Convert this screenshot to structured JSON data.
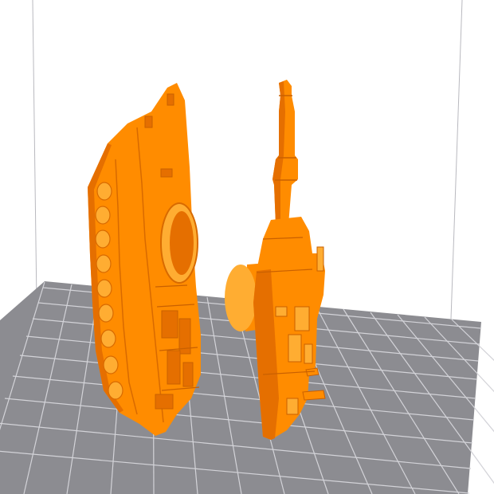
{
  "viewport": {
    "background_color": "#ffffff",
    "build_plate_color": "#8c8c91",
    "grid_line_color": "#d3d3d8",
    "volume_line_color": "#b9b9bf",
    "model_color": "#ff8c00",
    "model_shade_color": "#e56f00",
    "model_highlight_color": "#ffad32"
  },
  "models": [
    {
      "name": "tank-hull-side-part"
    },
    {
      "name": "tank-turret-barrel-part"
    }
  ]
}
